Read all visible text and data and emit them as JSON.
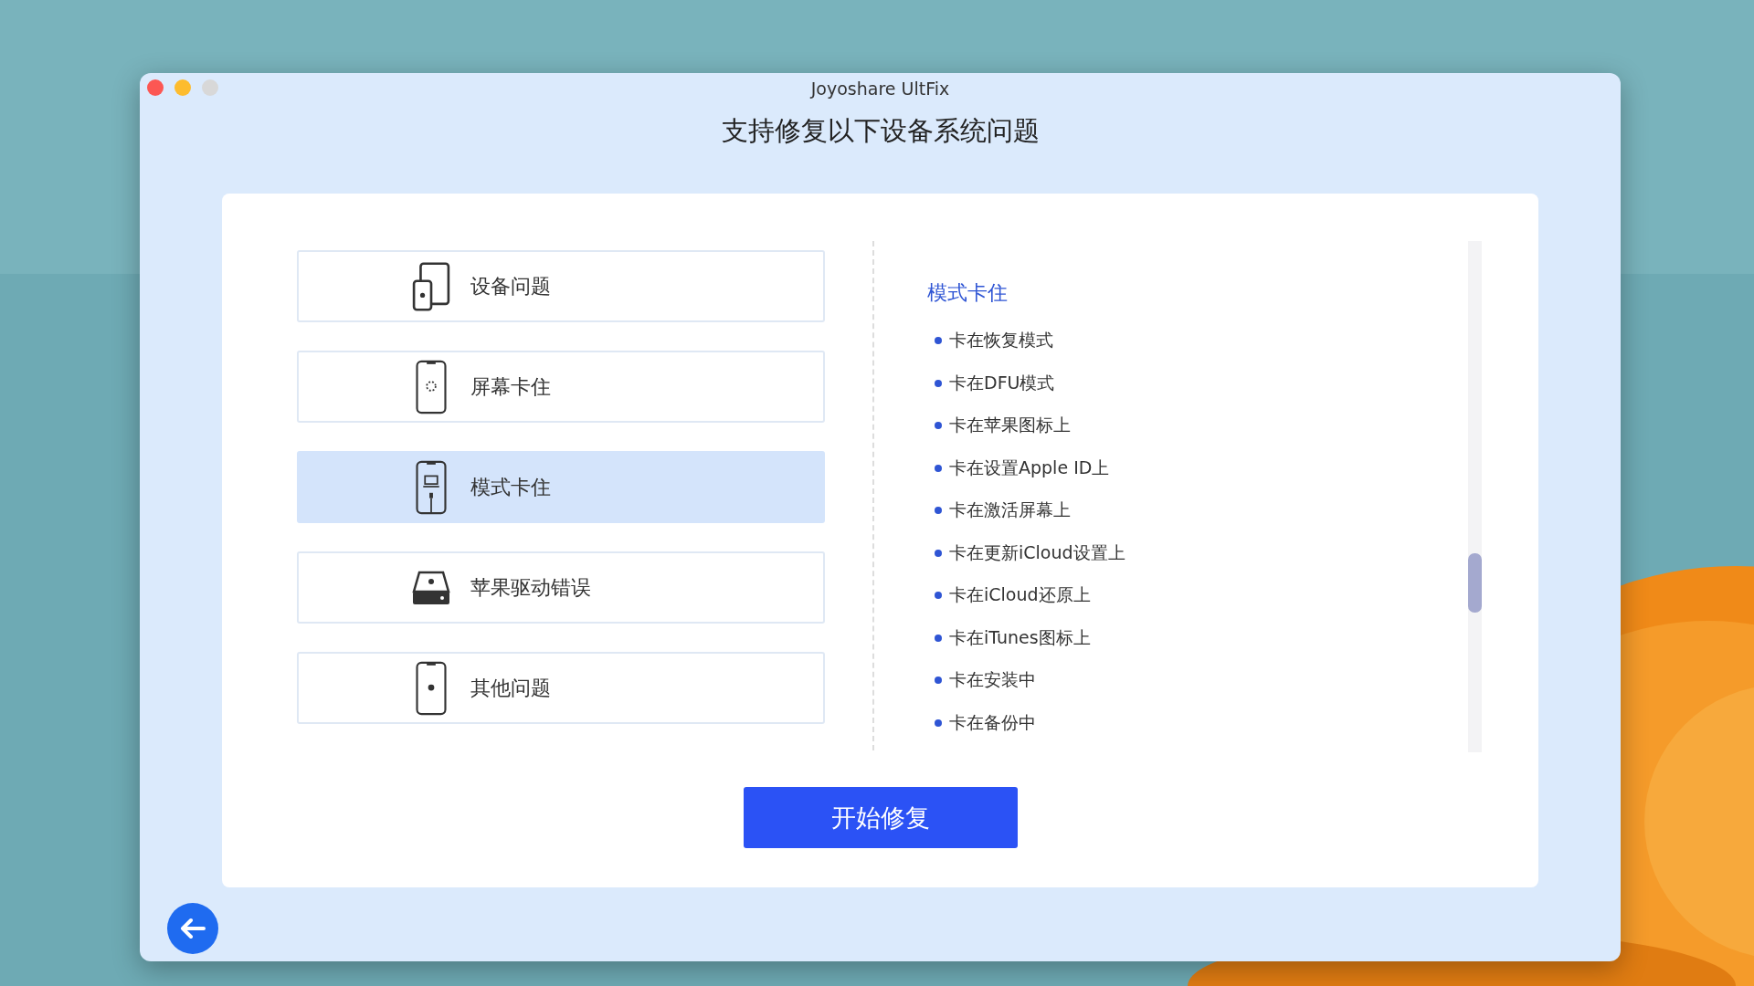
{
  "window": {
    "title": "Joyoshare UltFix"
  },
  "heading": "支持修复以下设备系统问题",
  "categories": [
    {
      "label": "设备问题",
      "selected": false
    },
    {
      "label": "屏幕卡住",
      "selected": false
    },
    {
      "label": "模式卡住",
      "selected": true
    },
    {
      "label": "苹果驱动错误",
      "selected": false
    },
    {
      "label": "其他问题",
      "selected": false
    }
  ],
  "details": {
    "title": "模式卡住",
    "items": [
      "卡在恢复模式",
      "卡在DFU模式",
      "卡在苹果图标上",
      "卡在设置Apple ID上",
      "卡在激活屏幕上",
      "卡在更新iCloud设置上",
      "卡在iCloud还原上",
      "卡在iTunes图标上",
      "卡在安装中",
      "卡在备份中"
    ]
  },
  "start_button": "开始修复"
}
